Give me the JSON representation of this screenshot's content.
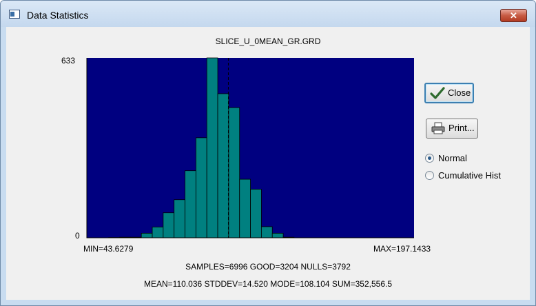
{
  "window": {
    "title": "Data Statistics",
    "close_glyph": "✕"
  },
  "chart": {
    "title": "SLICE_U_0MEAN_GR.GRD",
    "y_max_label": "633",
    "y_min_label": "0",
    "min_label": "MIN=43.6279",
    "max_label": "MAX=197.1433"
  },
  "stats": {
    "line1": "SAMPLES=6996   GOOD=3204   NULLS=3792",
    "line2": "MEAN=110.036   STDDEV=14.520   MODE=108.104   SUM=352,556.5"
  },
  "buttons": {
    "close_label": "Close",
    "print_label": "Print..."
  },
  "options": {
    "normal_label": "Normal",
    "cumulative_label": "Cumulative Hist",
    "selected": "normal"
  },
  "colors": {
    "plot_bg": "#000080",
    "bar_fill": "#008080",
    "mean_line": "#000000"
  },
  "icons": {
    "close_button_icon": "checkmark-icon",
    "print_button_icon": "printer-icon"
  },
  "chart_data": {
    "type": "bar",
    "title": "SLICE_U_0MEAN_GR.GRD",
    "xlabel": "",
    "ylabel": "",
    "xlim": [
      43.6279,
      197.1433
    ],
    "ylim": [
      0,
      633
    ],
    "bin_edges": [
      43.63,
      48.75,
      53.87,
      58.99,
      64.1,
      69.22,
      74.34,
      79.46,
      84.57,
      89.69,
      94.81,
      99.93,
      105.05,
      110.17,
      115.29,
      120.41,
      125.53,
      130.64,
      135.76,
      140.88,
      146.0,
      151.12,
      156.24,
      161.35,
      166.47,
      171.59,
      176.71,
      181.83,
      186.95,
      192.06,
      197.14
    ],
    "values": [
      0,
      0,
      1,
      2,
      2,
      16,
      38,
      88,
      134,
      236,
      352,
      633,
      507,
      458,
      206,
      171,
      39,
      16,
      2,
      0,
      0,
      0,
      0,
      0,
      0,
      0,
      0,
      0,
      0,
      0
    ],
    "mean": 110.036,
    "mode": 108.104,
    "grid": false,
    "legend": "none"
  }
}
